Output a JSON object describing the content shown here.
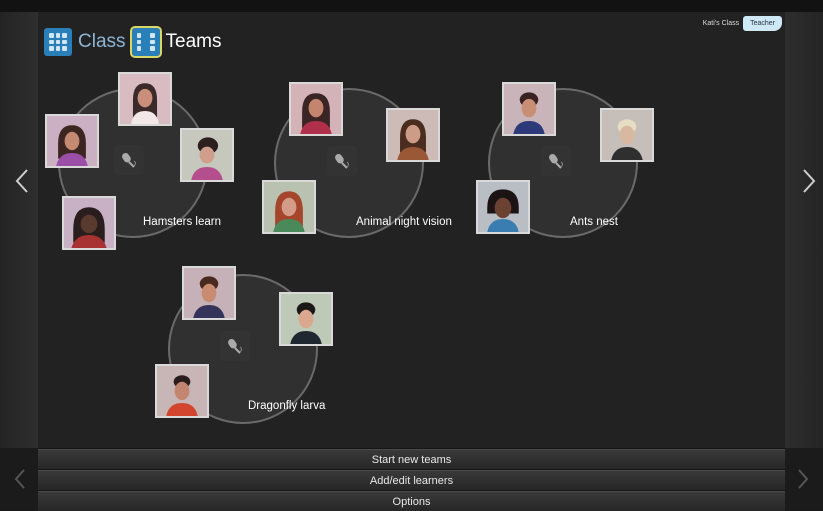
{
  "header": {
    "class_label": "Class",
    "teams_label": "Teams",
    "class_name": "Kati's Class",
    "role_label": "Teacher"
  },
  "teams": [
    {
      "name": "Hamsters learn",
      "members": 4
    },
    {
      "name": "Animal night vision",
      "members": 3
    },
    {
      "name": "Ants nest",
      "members": 3
    },
    {
      "name": "Dragonfly larva",
      "members": 3
    }
  ],
  "menu": {
    "start_new_teams": "Start new teams",
    "add_edit_learners": "Add/edit learners",
    "options": "Options"
  },
  "colors": {
    "accent": "#2a7fb8",
    "highlight": "#d8d76a",
    "role_button": "#cfe8f6"
  }
}
